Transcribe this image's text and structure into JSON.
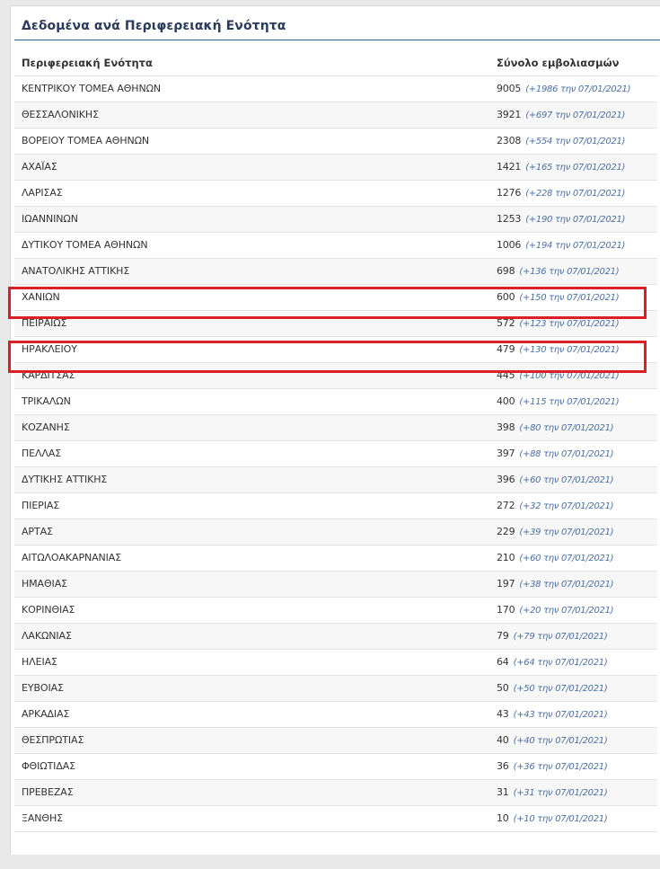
{
  "panel": {
    "title": "Δεδομένα ανά Περιφερειακή Ενότητα",
    "col_region": "Περιφερειακή Ενότητα",
    "col_total": "Σύνολο εμβολιασμών"
  },
  "rows": [
    {
      "region": "ΚΕΝΤΡΙΚΟΥ ΤΟΜΕΑ ΑΘΗΝΩΝ",
      "total": "9005",
      "change": "(+1986 την 07/01/2021)"
    },
    {
      "region": "ΘΕΣΣΑΛΟΝΙΚΗΣ",
      "total": "3921",
      "change": "(+697 την 07/01/2021)"
    },
    {
      "region": "ΒΟΡΕΙΟΥ ΤΟΜΕΑ ΑΘΗΝΩΝ",
      "total": "2308",
      "change": "(+554 την 07/01/2021)"
    },
    {
      "region": "ΑΧΑΪΑΣ",
      "total": "1421",
      "change": "(+165 την 07/01/2021)"
    },
    {
      "region": "ΛΑΡΙΣΑΣ",
      "total": "1276",
      "change": "(+228 την 07/01/2021)"
    },
    {
      "region": "ΙΩΑΝΝΙΝΩΝ",
      "total": "1253",
      "change": "(+190 την 07/01/2021)"
    },
    {
      "region": "ΔΥΤΙΚΟΥ ΤΟΜΕΑ ΑΘΗΝΩΝ",
      "total": "1006",
      "change": "(+194 την 07/01/2021)"
    },
    {
      "region": "ΑΝΑΤΟΛΙΚΗΣ ΑΤΤΙΚΗΣ",
      "total": "698",
      "change": "(+136 την 07/01/2021)"
    },
    {
      "region": "ΧΑΝΙΩΝ",
      "total": "600",
      "change": "(+150 την 07/01/2021)"
    },
    {
      "region": "ΠΕΙΡΑΙΩΣ",
      "total": "572",
      "change": "(+123 την 07/01/2021)"
    },
    {
      "region": "ΗΡΑΚΛΕΙΟΥ",
      "total": "479",
      "change": "(+130 την 07/01/2021)"
    },
    {
      "region": "ΚΑΡΔΙΤΣΑΣ",
      "total": "445",
      "change": "(+100 την 07/01/2021)"
    },
    {
      "region": "ΤΡΙΚΑΛΩΝ",
      "total": "400",
      "change": "(+115 την 07/01/2021)"
    },
    {
      "region": "ΚΟΖΑΝΗΣ",
      "total": "398",
      "change": "(+80 την 07/01/2021)"
    },
    {
      "region": "ΠΕΛΛΑΣ",
      "total": "397",
      "change": "(+88 την 07/01/2021)"
    },
    {
      "region": "ΔΥΤΙΚΗΣ ΑΤΤΙΚΗΣ",
      "total": "396",
      "change": "(+60 την 07/01/2021)"
    },
    {
      "region": "ΠΙΕΡΙΑΣ",
      "total": "272",
      "change": "(+32 την 07/01/2021)"
    },
    {
      "region": "ΑΡΤΑΣ",
      "total": "229",
      "change": "(+39 την 07/01/2021)"
    },
    {
      "region": "ΑΙΤΩΛΟΑΚΑΡΝΑΝΙΑΣ",
      "total": "210",
      "change": "(+60 την 07/01/2021)"
    },
    {
      "region": "ΗΜΑΘΙΑΣ",
      "total": "197",
      "change": "(+38 την 07/01/2021)"
    },
    {
      "region": "ΚΟΡΙΝΘΙΑΣ",
      "total": "170",
      "change": "(+20 την 07/01/2021)"
    },
    {
      "region": "ΛΑΚΩΝΙΑΣ",
      "total": "79",
      "change": "(+79 την 07/01/2021)"
    },
    {
      "region": "ΗΛΕΙΑΣ",
      "total": "64",
      "change": "(+64 την 07/01/2021)"
    },
    {
      "region": "ΕΥΒΟΙΑΣ",
      "total": "50",
      "change": "(+50 την 07/01/2021)"
    },
    {
      "region": "ΑΡΚΑΔΙΑΣ",
      "total": "43",
      "change": "(+43 την 07/01/2021)"
    },
    {
      "region": "ΘΕΣΠΡΩΤΙΑΣ",
      "total": "40",
      "change": "(+40 την 07/01/2021)"
    },
    {
      "region": "ΦΘΙΩΤΙΔΑΣ",
      "total": "36",
      "change": "(+36 την 07/01/2021)"
    },
    {
      "region": "ΠΡΕΒΕΖΑΣ",
      "total": "31",
      "change": "(+31 την 07/01/2021)"
    },
    {
      "region": "ΞΑΝΘΗΣ",
      "total": "10",
      "change": "(+10 την 07/01/2021)"
    }
  ],
  "colors": {
    "title": "#2a3b5c",
    "rule": "#2a5d87",
    "change_text": "#4a6fa5",
    "highlight": "#dc1f26"
  }
}
